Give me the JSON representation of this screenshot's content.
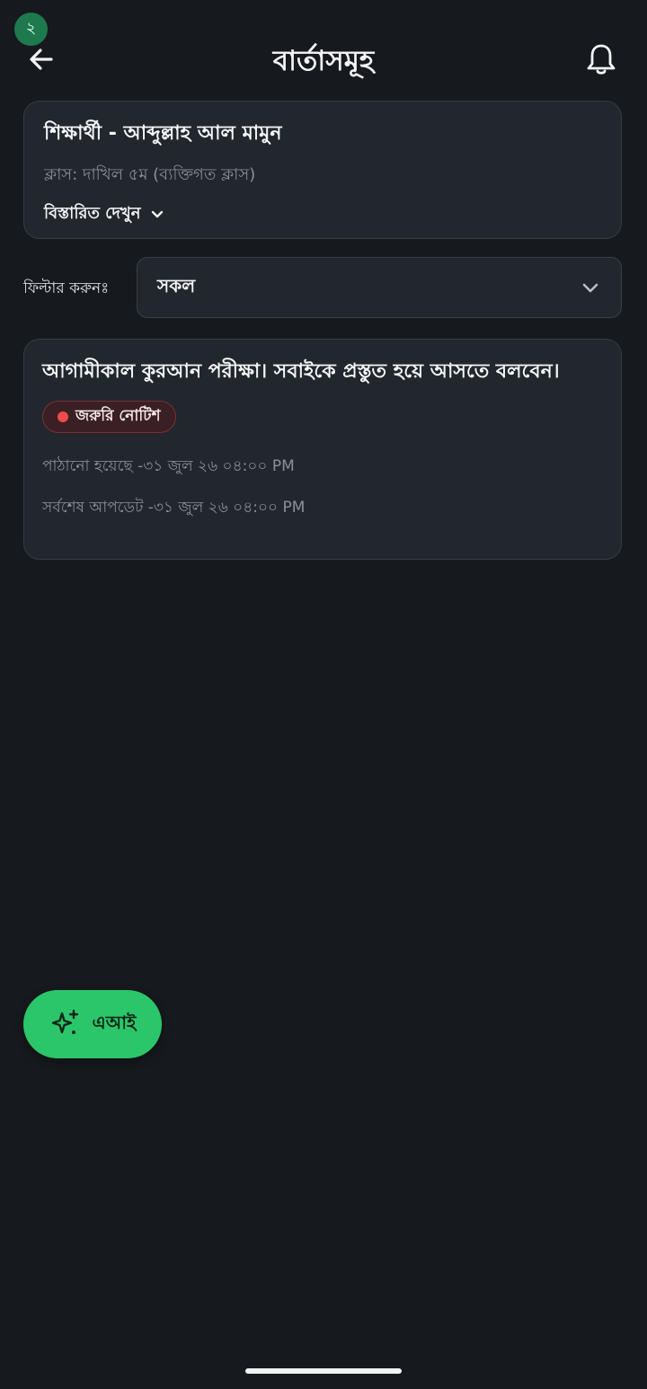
{
  "status": {
    "notification_count": "২"
  },
  "header": {
    "title": "বার্তাসমূহ",
    "back_icon": "arrow-left-icon",
    "bell_icon": "bell-icon"
  },
  "student": {
    "name": "শিক্ষার্থী - আব্দুল্লাহ আল মামুন",
    "class_info": "ক্লাস: দাখিল ৫ম  (ব্যক্তিগত ক্লাস)",
    "details_label": "বিস্তারিত দেখুন"
  },
  "filter": {
    "label": "ফিল্টার করুনঃ",
    "selected": "সকল"
  },
  "messages": [
    {
      "text": "আগামীকাল কুরআন পরীক্ষা। সবাইকে প্রস্তুত হয়ে আসতে বলবেন।",
      "badge": "জরুরি নোটিশ",
      "sent": "পাঠানো হয়েছে -৩১ জুল ২৬ ০৪:০০ PM",
      "updated": "সর্বশেষ আপডেট -৩১ জুল ২৬ ০৪:০০ PM"
    }
  ],
  "fab": {
    "label": "এআই",
    "icon": "sparkles-icon"
  },
  "colors": {
    "background": "#16191d",
    "card": "#22262d",
    "accent_green": "#2cc66a",
    "badge_green": "#1e7a4e",
    "urgent_red": "#ef4b4b"
  }
}
